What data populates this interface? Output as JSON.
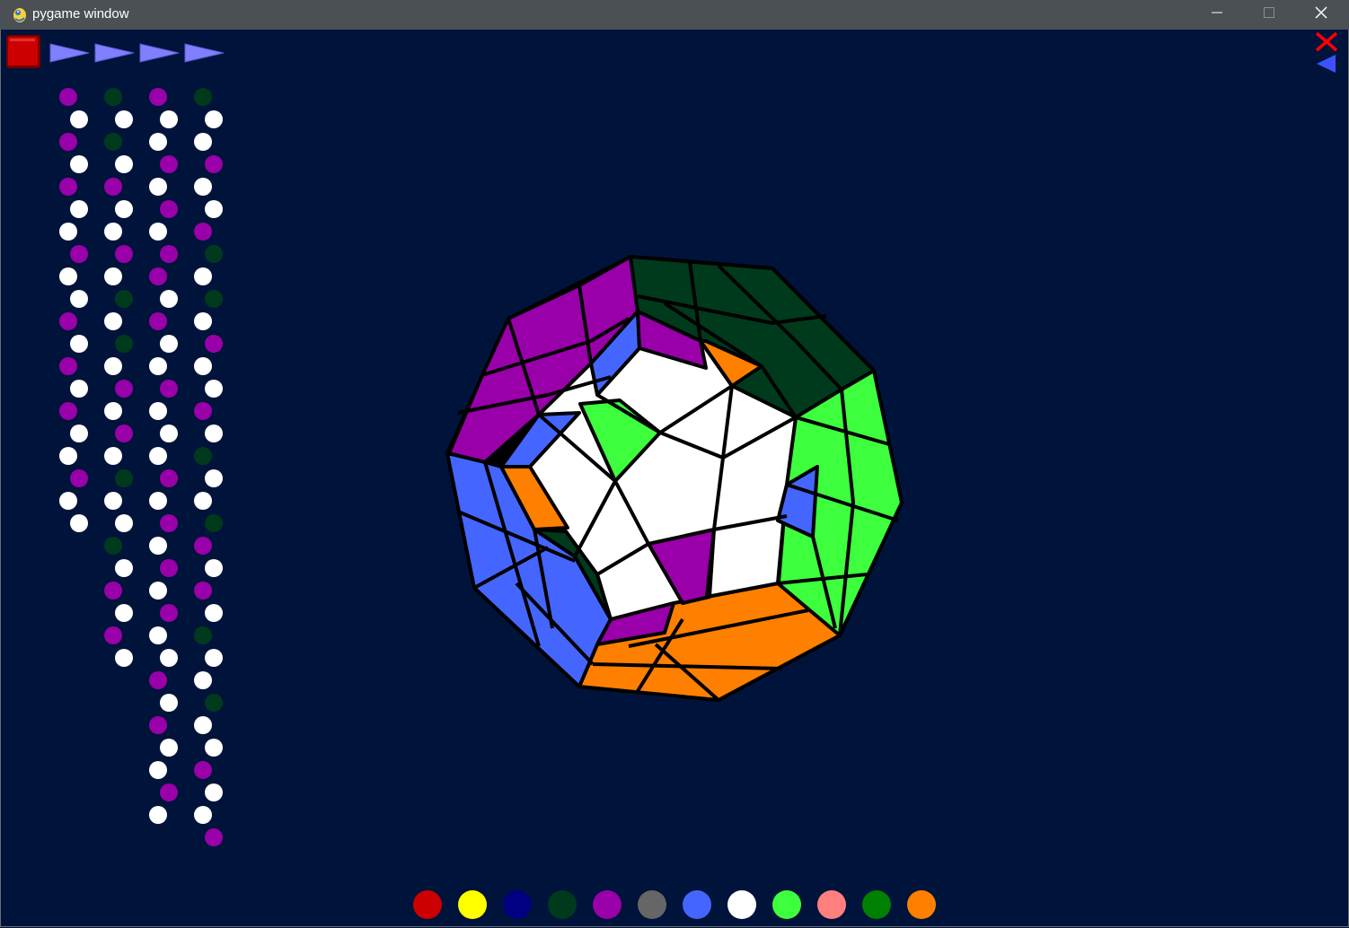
{
  "window": {
    "title": "pygame window",
    "controls": [
      "minimize",
      "maximize",
      "close"
    ]
  },
  "toolbar": {
    "stop_button": {
      "icon": "stop-square-icon",
      "color": "#cc0000"
    },
    "play_buttons": [
      {
        "icon": "play-right-icon"
      },
      {
        "icon": "play-right-icon"
      },
      {
        "icon": "play-right-icon"
      },
      {
        "icon": "play-right-icon"
      }
    ],
    "close_icon": {
      "icon": "close-x-icon",
      "color": "#ff0000"
    },
    "back_icon": {
      "icon": "play-left-icon",
      "color": "#3d52ff"
    }
  },
  "colors": {
    "background": "#00133a",
    "white": "#ffffff",
    "purple": "#9900aa",
    "dark_green": "#003a1d",
    "green": "#3dff3d",
    "blue": "#4466ff",
    "orange": "#ff7f00",
    "outline": "#000000",
    "arrow": "#7f7fff"
  },
  "move_sequence_columns": [
    [
      "P",
      "W",
      "P",
      "W",
      "P",
      "W",
      "W",
      "P",
      "W",
      "W",
      "P",
      "W",
      "P",
      "W",
      "P",
      "W",
      "W",
      "P",
      "W",
      "W"
    ],
    [
      "G",
      "W",
      "G",
      "W",
      "P",
      "W",
      "W",
      "P",
      "W",
      "G",
      "W",
      "G",
      "W",
      "P",
      "W",
      "P",
      "W",
      "G",
      "W",
      "W",
      "G",
      "W",
      "P",
      "W",
      "P",
      "W"
    ],
    [
      "P",
      "W",
      "W",
      "P",
      "W",
      "P",
      "W",
      "P",
      "P",
      "W",
      "P",
      "W",
      "W",
      "P",
      "W",
      "W",
      "W",
      "P",
      "W",
      "P",
      "W",
      "P",
      "W",
      "P",
      "W",
      "W",
      "P",
      "W",
      "P",
      "W",
      "W",
      "P",
      "W"
    ],
    [
      "G",
      "W",
      "W",
      "P",
      "W",
      "W",
      "P",
      "G",
      "W",
      "G",
      "W",
      "P",
      "W",
      "W",
      "P",
      "W",
      "G",
      "W",
      "W",
      "G",
      "P",
      "W",
      "P",
      "W",
      "G",
      "W",
      "W",
      "G",
      "W",
      "W",
      "P",
      "W",
      "W",
      "P"
    ]
  ],
  "palette": [
    {
      "name": "red",
      "color": "#cc0000"
    },
    {
      "name": "yellow",
      "color": "#ffff00"
    },
    {
      "name": "navy",
      "color": "#000080"
    },
    {
      "name": "dark-green",
      "color": "#003a1d"
    },
    {
      "name": "purple",
      "color": "#9900aa"
    },
    {
      "name": "gray",
      "color": "#666666"
    },
    {
      "name": "blue",
      "color": "#4466ff"
    },
    {
      "name": "white",
      "color": "#ffffff"
    },
    {
      "name": "green",
      "color": "#3dff3d"
    },
    {
      "name": "pink",
      "color": "#ff7f7f"
    },
    {
      "name": "green-2",
      "color": "#008000"
    },
    {
      "name": "orange",
      "color": "#ff7f00"
    }
  ],
  "megaminx": {
    "front_face": [
      "W",
      "W",
      "W",
      "W",
      "W",
      "W",
      "G",
      "W",
      "P",
      "W",
      "W"
    ],
    "faces": [
      {
        "name": "front",
        "color": "white"
      },
      {
        "name": "top-right",
        "color": "dark_green"
      },
      {
        "name": "top-left",
        "color": "purple"
      },
      {
        "name": "right",
        "color": "green"
      },
      {
        "name": "bottom",
        "color": "orange"
      },
      {
        "name": "left",
        "color": "blue"
      }
    ]
  }
}
